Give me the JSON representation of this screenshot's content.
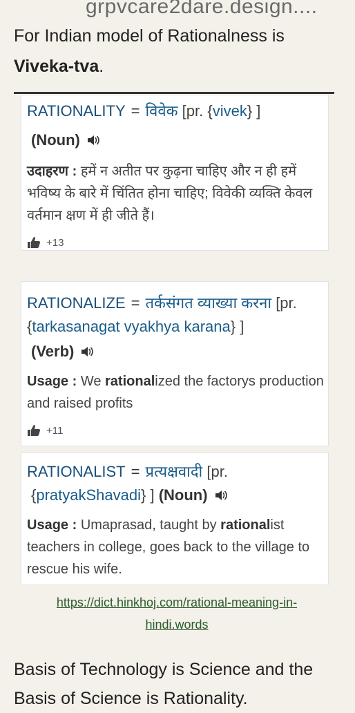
{
  "header": {
    "domain": "grpvcare2dare.design...."
  },
  "intro": {
    "text": "For Indian model of Rationalness is",
    "bold": "Viveka-tva",
    "tail": "."
  },
  "entries": [
    {
      "word": "RATIONALITY",
      "eq": "=",
      "hindi": "विवेक",
      "pr_open": "[pr. {",
      "pron": "vivek",
      "pr_close": "} ]",
      "pos": "(Noun)",
      "example_label": "उदाहरण :",
      "example_text": "हमें न अतीत पर कुढ़ना चाहिए और न ही हमें भविष्य के बारे में चिंतित होना चाहिए; विवेकी व्यक्ति केवल वर्तमान क्षण में ही जीते हैं।",
      "likes": "+13"
    },
    {
      "word": "RATIONALIZE",
      "eq": "=",
      "hindi": "तर्कसंगत व्याख्या करना",
      "pr_open": "[pr. {",
      "pron": "tarkasanagat vyakhya karana",
      "pr_close": "} ]",
      "pos": "(Verb)",
      "example_label": "Usage :",
      "example_pre": "We ",
      "example_bold": "rational",
      "example_post": "ized the factorys production and raised profits",
      "likes": "+11"
    },
    {
      "word": "RATIONALIST",
      "eq": "=",
      "hindi": "प्रत्यक्षवादी",
      "pr_open": "[pr.",
      "pron_open": "{",
      "pron": "pratyakShavadi",
      "pr_close": "} ]",
      "pos": "(Noun)",
      "example_label": "Usage :",
      "example_pre": "Umaprasad, taught by ",
      "example_bold": "rational",
      "example_post": "ist teachers in college, goes back to the village to rescue his wife."
    }
  ],
  "source": {
    "line1": "https://dict.hinkhoj.com/rational-meaning-in-",
    "line2": "hindi.words"
  },
  "outro": {
    "text": "Basis of Technology is Science and the Basis of Science is Rationality."
  },
  "icons": {
    "speaker": "speaker-icon",
    "thumb": "thumbs-up-icon"
  },
  "colors": {
    "word": "#1a4f7a",
    "link": "#2a5c2a",
    "background": "#f4f0ea"
  }
}
